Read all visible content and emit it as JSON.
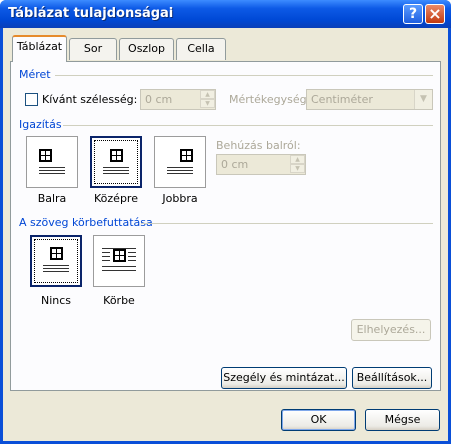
{
  "window": {
    "title": "Táblázat tulajdonságai",
    "help_label": "?",
    "close_label": "×"
  },
  "tabs": [
    {
      "label": "Táblázat"
    },
    {
      "label": "Sor"
    },
    {
      "label": "Oszlop"
    },
    {
      "label": "Cella"
    }
  ],
  "size": {
    "section_label": "Méret",
    "preferred_width_label": "Kívánt szélesség:",
    "preferred_width_value": "0 cm",
    "unit_label": "Mértékegység:",
    "unit_value": "Centiméter"
  },
  "alignment": {
    "section_label": "Igazítás",
    "options": [
      "Balra",
      "Középre",
      "Jobbra"
    ],
    "indent_label": "Behúzás balról:",
    "indent_value": "0 cm"
  },
  "wrapping": {
    "section_label": "A szöveg körbefuttatása",
    "options": [
      "Nincs",
      "Körbe"
    ],
    "positioning_button": "Elhelyezés..."
  },
  "buttons": {
    "borders": "Szegély és mintázat...",
    "options": "Beállítások...",
    "ok": "OK",
    "cancel": "Mégse"
  }
}
